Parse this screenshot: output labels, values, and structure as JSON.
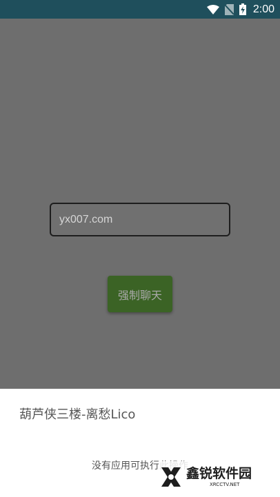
{
  "status_bar": {
    "time": "2:00",
    "icons": [
      "wifi-icon",
      "no-sim-icon",
      "battery-charging-icon"
    ],
    "background": "#1f4f5c"
  },
  "main": {
    "url_input": {
      "value": "yx007.com",
      "placeholder": ""
    },
    "chat_button_label": "强制聊天",
    "background": "#6e6e6e",
    "button_color": "#3b6325"
  },
  "bottom_sheet": {
    "title": "葫芦侠三楼-离愁Lico",
    "message": "没有应用可执行此操作"
  },
  "watermark": {
    "name": "鑫锐软件园",
    "url": "XRCCTV.NET",
    "logo_icon": "x-logo-icon"
  }
}
